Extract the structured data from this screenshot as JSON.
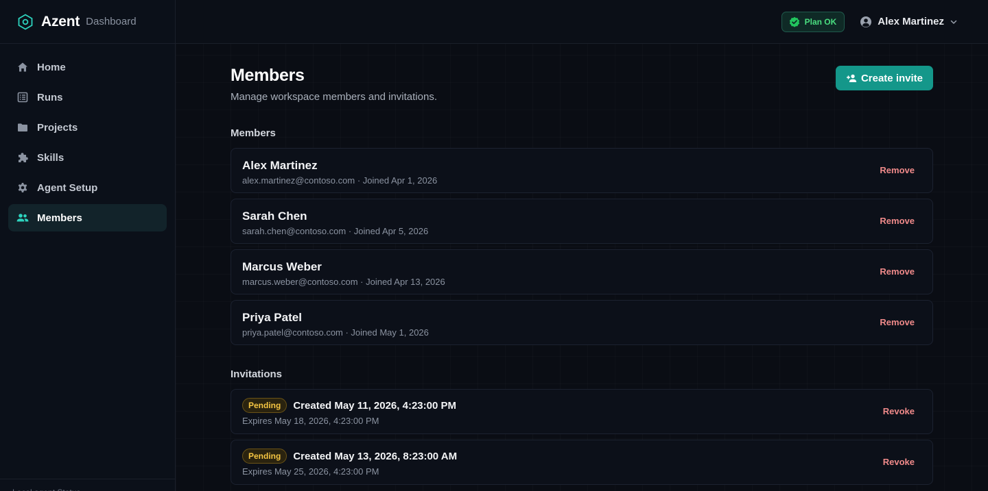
{
  "brand": {
    "name": "Azent",
    "subtitle": "Dashboard"
  },
  "sidebar": {
    "items": [
      {
        "label": "Home",
        "icon": "home-icon",
        "active": false
      },
      {
        "label": "Runs",
        "icon": "list-icon",
        "active": false
      },
      {
        "label": "Projects",
        "icon": "folder-icon",
        "active": false
      },
      {
        "label": "Skills",
        "icon": "puzzle-icon",
        "active": false
      },
      {
        "label": "Agent Setup",
        "icon": "gear-icon",
        "active": false
      },
      {
        "label": "Members",
        "icon": "users-icon",
        "active": true
      }
    ],
    "footer_text": "Local agent Status"
  },
  "topbar": {
    "plan_badge": "Plan OK",
    "user_name": "Alex Martinez"
  },
  "page": {
    "title": "Members",
    "subtitle": "Manage workspace members and invitations.",
    "create_button": "Create invite"
  },
  "members_section": {
    "title": "Members",
    "items": [
      {
        "name": "Alex Martinez",
        "meta": "alex.martinez@contoso.com · Joined Apr 1, 2026",
        "action": "Remove"
      },
      {
        "name": "Sarah Chen",
        "meta": "sarah.chen@contoso.com · Joined Apr 5, 2026",
        "action": "Remove"
      },
      {
        "name": "Marcus Weber",
        "meta": "marcus.weber@contoso.com · Joined Apr 13, 2026",
        "action": "Remove"
      },
      {
        "name": "Priya Patel",
        "meta": "priya.patel@contoso.com · Joined May 1, 2026",
        "action": "Remove"
      }
    ]
  },
  "invitations_section": {
    "title": "Invitations",
    "items": [
      {
        "status": "Pending",
        "created": "Created May 11, 2026, 4:23:00 PM",
        "expires": "Expires May 18, 2026, 4:23:00 PM",
        "action": "Revoke"
      },
      {
        "status": "Pending",
        "created": "Created May 13, 2026, 8:23:00 AM",
        "expires": "Expires May 25, 2026, 4:23:00 PM",
        "action": "Revoke"
      }
    ]
  },
  "colors": {
    "accent": "#14978a",
    "accent_light": "#2dd4bf",
    "danger_text": "#f08a8a",
    "pending": "#f5c542",
    "background": "#0a0d14"
  }
}
